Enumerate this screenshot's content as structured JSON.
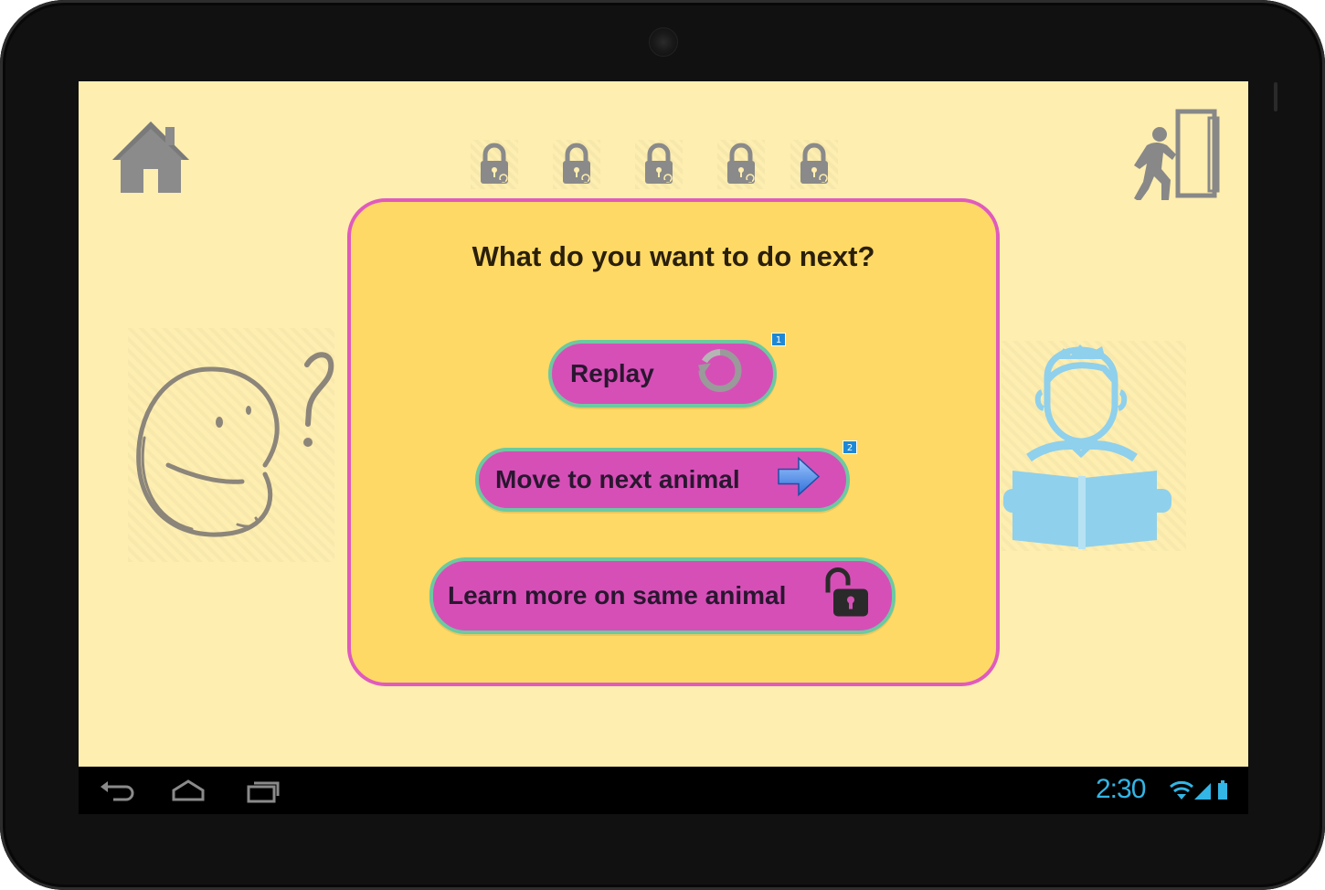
{
  "dialog": {
    "title": "What do you want to do next?",
    "buttons": [
      {
        "label": "Replay",
        "icon": "replay-icon",
        "badge": "1"
      },
      {
        "label": "Move to next animal",
        "icon": "arrow-right-icon",
        "badge": "2"
      },
      {
        "label": "Learn more on same animal",
        "icon": "unlock-icon"
      }
    ]
  },
  "levels": {
    "locks": [
      "locked",
      "locked",
      "locked",
      "locked",
      "locked"
    ]
  },
  "status_bar": {
    "time": "2:30"
  },
  "colors": {
    "screen_bg": "#feeeb0",
    "dialog_bg": "#ffd966",
    "dialog_border": "#e05bbd",
    "button_bg": "#d64fb7",
    "button_border": "#6cc9a0",
    "system_accent": "#33b5e5",
    "icon_gray": "#888888",
    "reader_blue": "#8fd0ec"
  }
}
